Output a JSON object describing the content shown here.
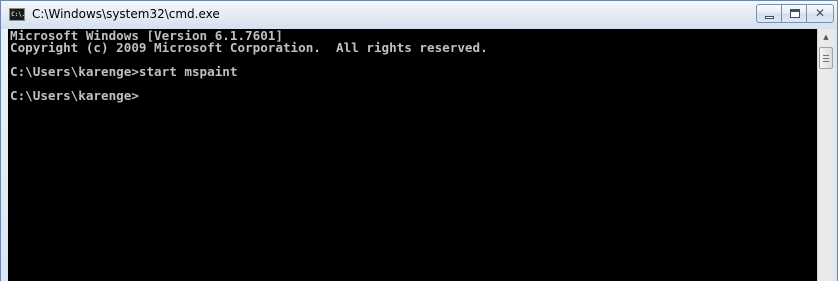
{
  "window": {
    "title": "C:\\Windows\\system32\\cmd.exe",
    "icon_text": "C:\\."
  },
  "caption_buttons": {
    "minimize": "minimize-icon",
    "maximize": "maximize-icon",
    "close": "close-icon",
    "close_glyph": "✕"
  },
  "console": {
    "lines": [
      "Microsoft Windows [Version 6.1.7601]",
      "Copyright (c) 2009 Microsoft Corporation.  All rights reserved.",
      "",
      "C:\\Users\\karenge>start mspaint",
      "",
      "C:\\Users\\karenge>"
    ]
  },
  "scrollbar": {
    "up_arrow": "▲"
  },
  "colors": {
    "console_bg": "#000000",
    "console_text": "#c0c0c0",
    "frame": "#dbe6f3"
  }
}
